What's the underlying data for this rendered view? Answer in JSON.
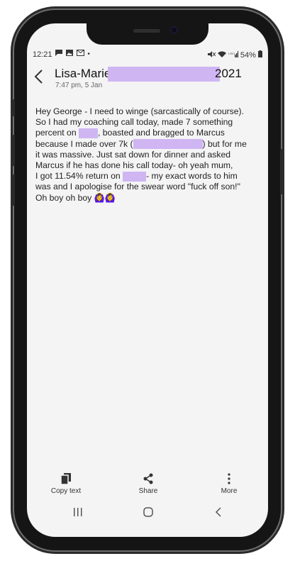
{
  "status_bar": {
    "time": "12:21",
    "left_icons": [
      "chat-icon",
      "image-icon",
      "gmail-icon",
      "dot"
    ],
    "battery": "54%"
  },
  "header": {
    "contact": "Lisa-Marie",
    "year": "2021",
    "timestamp": "7:47 pm, 5 Jan"
  },
  "message": {
    "lines": [
      [
        "Hey George - I need to winge (sarcastically of course)."
      ],
      [
        "So I had my coaching call today, made 7 something"
      ],
      [
        "percent on ",
        "",
        ", boasted and bragged to Marcus"
      ],
      [
        "because I made over 7k (",
        "",
        ") but for me"
      ],
      [
        "it was massive. Just sat down for dinner and asked"
      ],
      [
        "Marcus if he has done his call today- oh yeah mum,"
      ],
      [
        "I got 11.54% return on ",
        "",
        "- my exact words to him"
      ],
      [
        "was and I apologise for the swear word \"fuck off son!\""
      ],
      [
        "Oh boy oh boy 🙆‍♀️🙆‍♀️"
      ]
    ]
  },
  "toolbar": {
    "copy_label": "Copy text",
    "share_label": "Share",
    "more_label": "More"
  },
  "colors": {
    "redaction": "#cfb6f3",
    "background": "#f4f4f4"
  }
}
